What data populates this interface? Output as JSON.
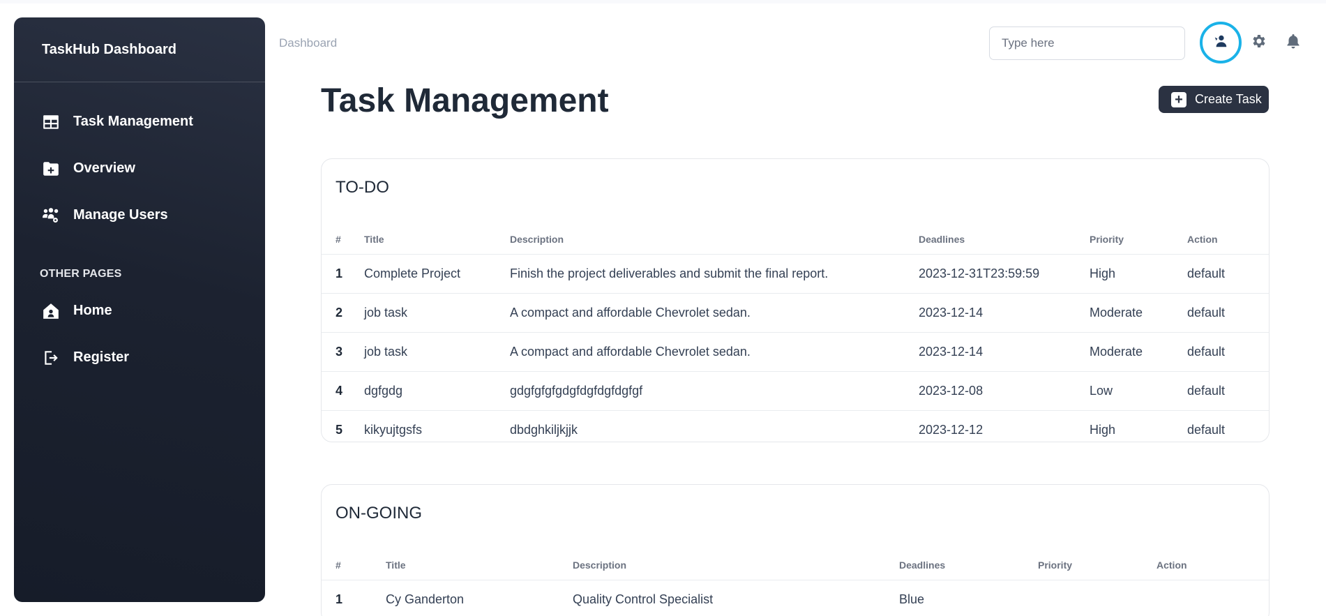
{
  "brand": "TaskHub Dashboard",
  "sidebar": {
    "items": [
      {
        "label": "Task Management",
        "icon": "table-icon"
      },
      {
        "label": "Overview",
        "icon": "folder-plus-icon"
      },
      {
        "label": "Manage Users",
        "icon": "users-gear-icon"
      }
    ],
    "section_label": "OTHER PAGES",
    "other": [
      {
        "label": "Home",
        "icon": "house-user-icon"
      },
      {
        "label": "Register",
        "icon": "sign-out-icon"
      }
    ]
  },
  "header": {
    "breadcrumb": "Dashboard",
    "search_placeholder": "Type here"
  },
  "main": {
    "title": "Task Management",
    "create_label": "Create Task"
  },
  "colors": {
    "sidebar_bg": "#1c2230",
    "accent_ring": "#1ab2e8",
    "button_bg": "#2b3242"
  },
  "todo": {
    "title": "TO-DO",
    "columns": [
      "#",
      "Title",
      "Description",
      "Deadlines",
      "Priority",
      "Action"
    ],
    "rows": [
      [
        "1",
        "Complete Project",
        "Finish the project deliverables and submit the final report.",
        "2023-12-31T23:59:59",
        "High",
        "default"
      ],
      [
        "2",
        "job task",
        "A compact and affordable Chevrolet sedan.",
        "2023-12-14",
        "Moderate",
        "default"
      ],
      [
        "3",
        "job task",
        "A compact and affordable Chevrolet sedan.",
        "2023-12-14",
        "Moderate",
        "default"
      ],
      [
        "4",
        "dgfgdg",
        "gdgfgfgfgdgfdgfdgfdgfgf",
        "2023-12-08",
        "Low",
        "default"
      ],
      [
        "5",
        "kikyujtgsfs",
        "dbdghkiljkjjk",
        "2023-12-12",
        "High",
        "default"
      ]
    ]
  },
  "ongoing": {
    "title": "ON-GOING",
    "columns": [
      "#",
      "Title",
      "Description",
      "Deadlines",
      "Priority",
      "Action"
    ],
    "rows": [
      [
        "1",
        "Cy Ganderton",
        "Quality Control Specialist",
        "Blue",
        "",
        ""
      ]
    ]
  }
}
